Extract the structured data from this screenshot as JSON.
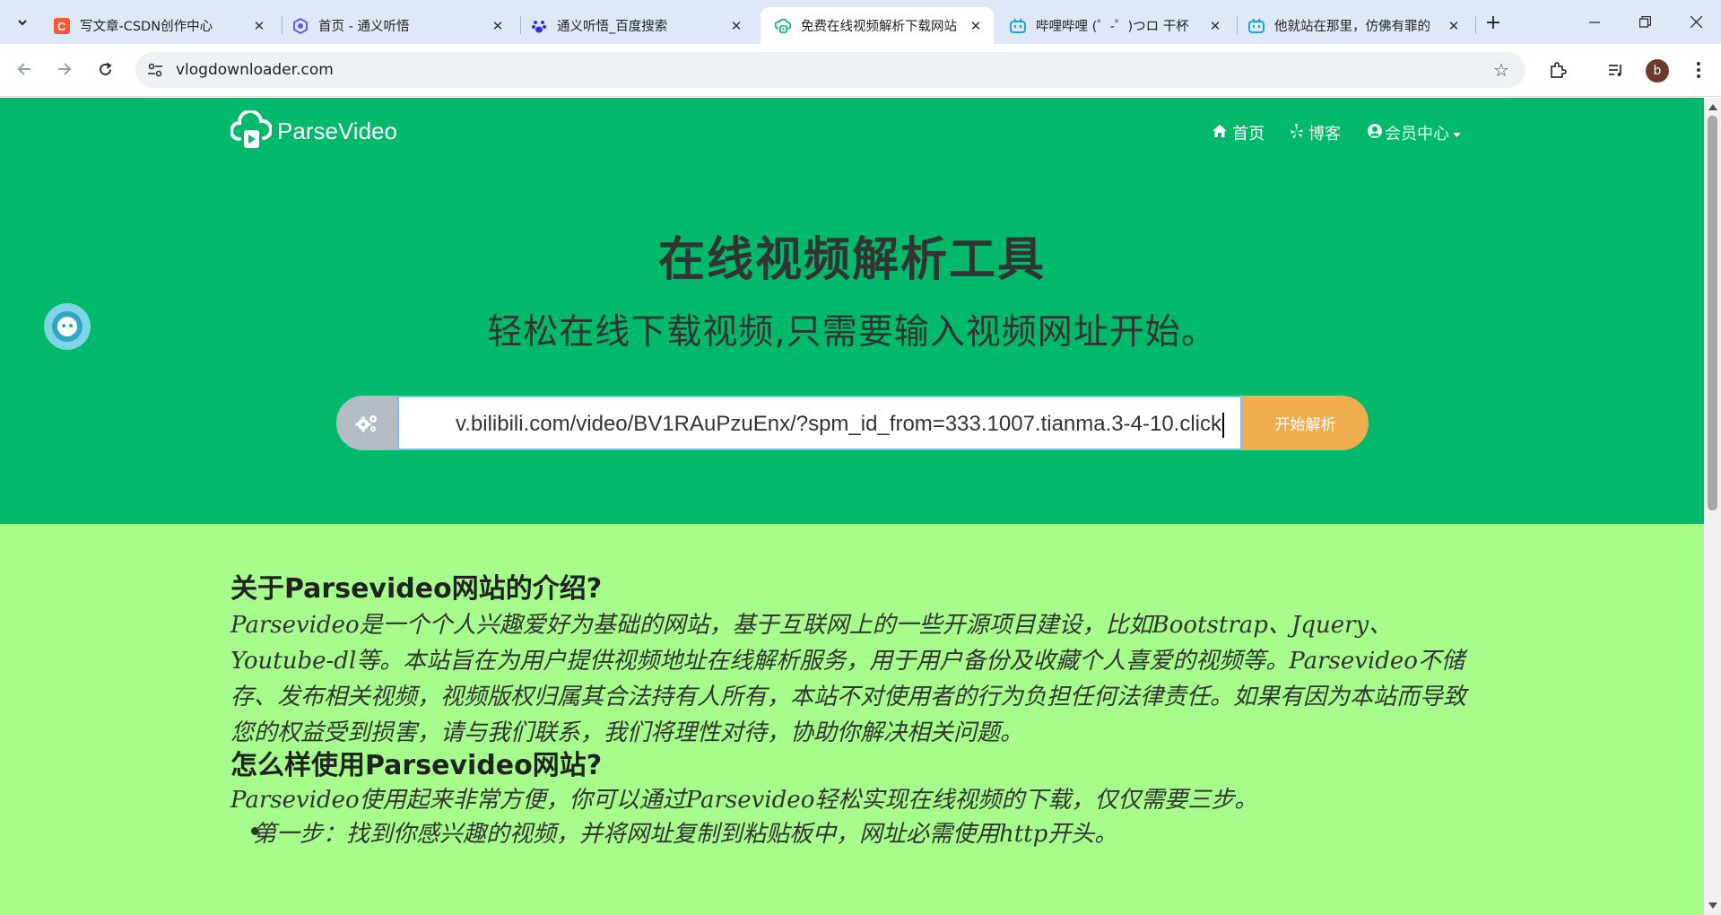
{
  "browser": {
    "tabs": [
      {
        "title": "写文章-CSDN创作中心",
        "icon": "csdn-icon",
        "active": false
      },
      {
        "title": "首页 - 通义听悟",
        "icon": "tongyi-icon",
        "active": false
      },
      {
        "title": "通义听悟_百度搜索",
        "icon": "baidu-paw-icon",
        "active": false
      },
      {
        "title": "免费在线视频解析下载网站",
        "icon": "parsevideo-icon",
        "active": true
      },
      {
        "title": "哔哩哔哩 (゜-゜)つロ 干杯",
        "icon": "bilibili-icon",
        "active": false
      },
      {
        "title": "他就站在那里，仿佛有罪的",
        "icon": "bilibili-icon",
        "active": false
      }
    ],
    "url": "vlogdownloader.com",
    "profile_initial": "b"
  },
  "site": {
    "brand": "ParseVideo",
    "nav": {
      "home": "首页",
      "blog": "博客",
      "member": "会员中心"
    },
    "hero_title": "在线视频解析工具",
    "hero_subtitle": "轻松在线下载视频,只需要输入视频网址开始。",
    "search": {
      "value": "v.bilibili.com/video/BV1RAuPzuEnx/?spm_id_from=333.1007.tianma.3-4-10.click",
      "button": "开始解析"
    },
    "about_heading": "关于Parsevideo网站的介绍?",
    "about_text": "Parsevideo是一个个人兴趣爱好为基础的网站，基于互联网上的一些开源项目建设，比如Bootstrap、Jquery、Youtube-dl等。本站旨在为用户提供视频地址在线解析服务，用于用户备份及收藏个人喜爱的视频等。Parsevideo不储存、发布相关视频，视频版权归属其合法持有人所有，本站不对使用者的行为负担任何法律责任。如果有因为本站而导致您的权益受到损害，请与我们联系，我们将理性对待，协助你解决相关问题。",
    "howto_heading": "怎么样使用Parsevideo网站?",
    "howto_text": "Parsevideo使用起来非常方便，你可以通过Parsevideo轻松实现在线视频的下载，仅仅需要三步。",
    "step1": "第一步：找到你感兴趣的视频，并将网址复制到粘贴板中，网址必需使用http开头。"
  },
  "colors": {
    "hero_bg": "#00b96b",
    "content_bg": "#a6fd8b",
    "button_bg": "#f0ad4e"
  }
}
